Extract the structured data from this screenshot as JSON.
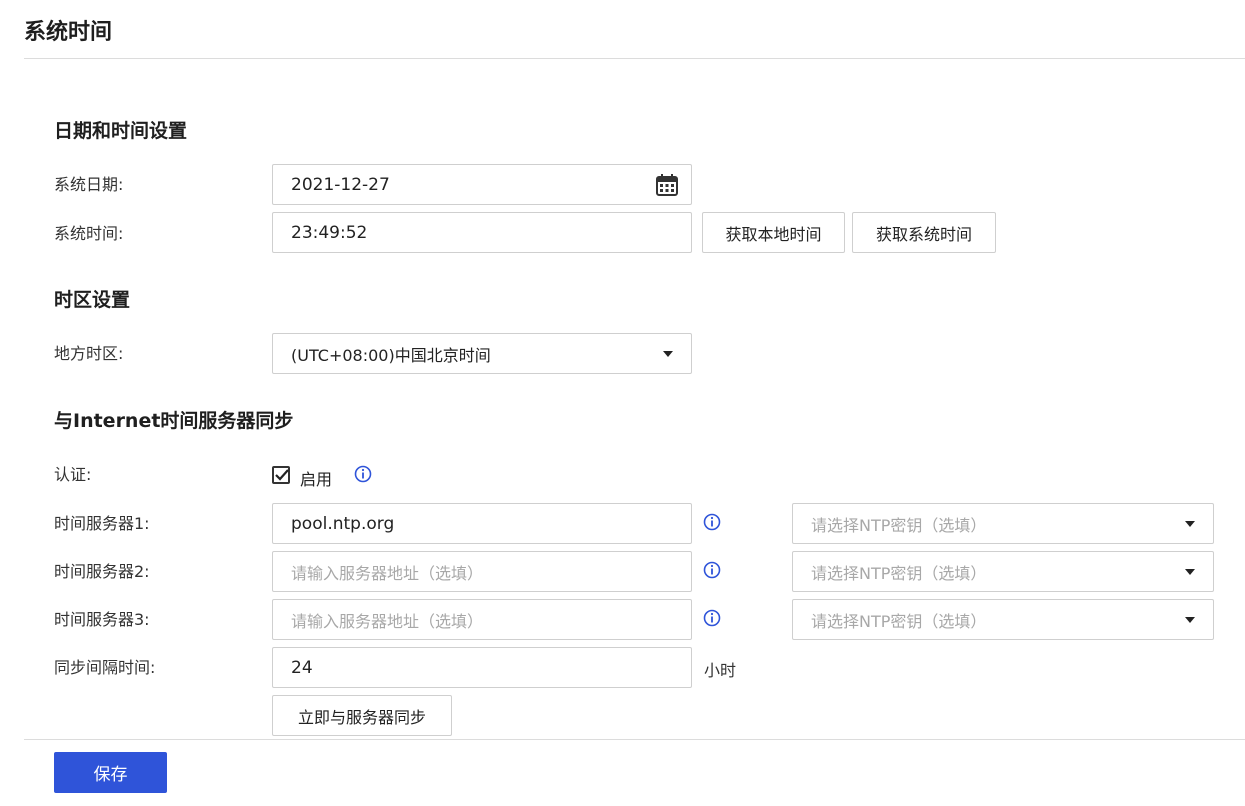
{
  "page": {
    "title": "系统时间"
  },
  "datetime_section": {
    "title": "日期和时间设置",
    "date_label": "系统日期:",
    "date_value": "2021-12-27",
    "time_label": "系统时间:",
    "time_value": "23:49:52",
    "get_local_time_label": "获取本地时间",
    "get_system_time_label": "获取系统时间"
  },
  "timezone_section": {
    "title": "时区设置",
    "timezone_label": "地方时区:",
    "timezone_value": "(UTC+08:00)中国北京时间"
  },
  "ntp_section": {
    "title": "与Internet时间服务器同步",
    "auth_label": "认证:",
    "auth_checkbox_label": "启用",
    "auth_enabled": true,
    "servers": [
      {
        "label": "时间服务器1:",
        "value": "pool.ntp.org",
        "placeholder": "请输入服务器地址（选填）",
        "key_placeholder": "请选择NTP密钥（选填）"
      },
      {
        "label": "时间服务器2:",
        "value": "",
        "placeholder": "请输入服务器地址（选填）",
        "key_placeholder": "请选择NTP密钥（选填）"
      },
      {
        "label": "时间服务器3:",
        "value": "",
        "placeholder": "请输入服务器地址（选填）",
        "key_placeholder": "请选择NTP密钥（选填）"
      }
    ],
    "interval_label": "同步间隔时间:",
    "interval_value": "24",
    "interval_unit": "小时",
    "sync_now_label": "立即与服务器同步"
  },
  "footer": {
    "save_label": "保存"
  },
  "icons": {
    "calendar": "calendar-icon",
    "info": "info-icon",
    "dropdown": "chevron-down-icon",
    "check": "check-icon"
  },
  "colors": {
    "primary": "#2f54d9",
    "info_icon": "#2f54d9",
    "border": "#cfcfcf",
    "placeholder": "#a8a8a8"
  }
}
